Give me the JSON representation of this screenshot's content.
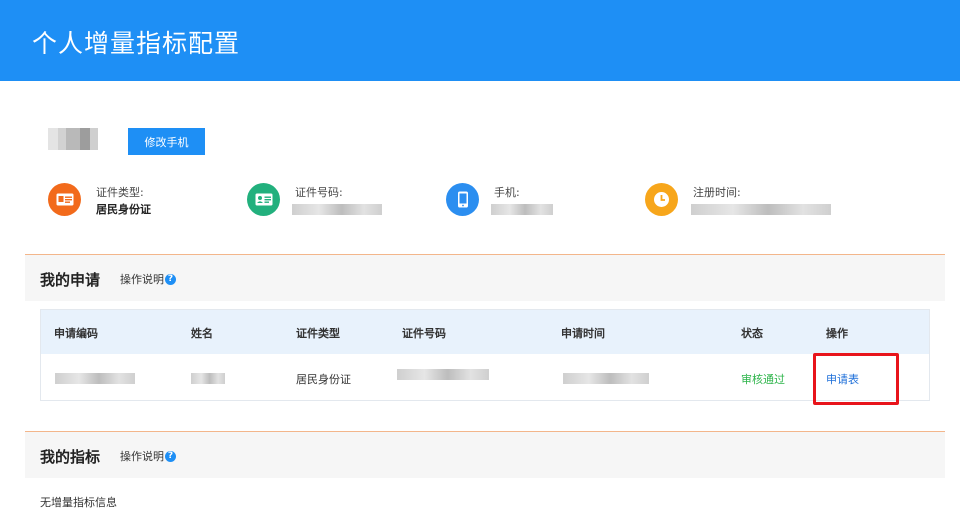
{
  "header": {
    "title": "个人增量指标配置"
  },
  "profile": {
    "edit_phone_button": "修改手机",
    "fields": [
      {
        "label": "证件类型:",
        "value": "居民身份证",
        "icon": "id-card-icon",
        "color": "#f26a1b"
      },
      {
        "label": "证件号码:",
        "value": "",
        "icon": "contact-card-icon",
        "color": "#22b07d"
      },
      {
        "label": "手机:",
        "value": "",
        "icon": "mobile-phone-icon",
        "color": "#2b8ef0"
      },
      {
        "label": "注册时间:",
        "value": "",
        "icon": "clock-icon",
        "color": "#f7a61b"
      }
    ]
  },
  "my_applications": {
    "title": "我的申请",
    "help_label": "操作说明",
    "columns": [
      "申请编码",
      "姓名",
      "证件类型",
      "证件号码",
      "申请时间",
      "状态",
      "操作"
    ],
    "rows": [
      {
        "code": "",
        "name": "",
        "id_type": "居民身份证",
        "id_number": "",
        "apply_time": "",
        "status": "审核通过",
        "action": "申请表"
      }
    ]
  },
  "my_indicators": {
    "title": "我的指标",
    "help_label": "操作说明",
    "empty_text": "无增量指标信息"
  },
  "colors": {
    "accent": "#1e8ff5",
    "success": "#2db44a",
    "link": "#1e6fd9",
    "highlight": "#e8141b"
  }
}
